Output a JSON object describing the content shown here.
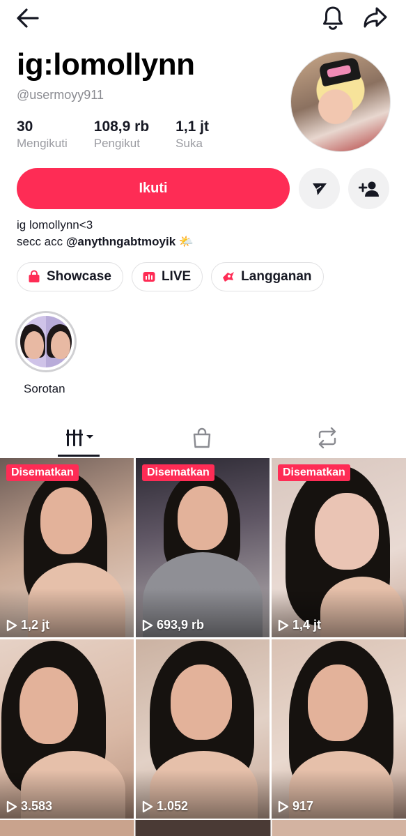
{
  "profile": {
    "display_name": "ig:lomollynn",
    "handle": "@usermoyy911",
    "stats": [
      {
        "value": "30",
        "label": "Mengikuti"
      },
      {
        "value": "108,9 rb",
        "label": "Pengikut"
      },
      {
        "value": "1,1 jt",
        "label": "Suka"
      }
    ],
    "follow_label": "Ikuti",
    "bio_line1": "ig lomollynn<3",
    "bio_line2_prefix": "secc acc ",
    "bio_line2_mention": "@anythngabtmoyik",
    "bio_line2_emoji": "🌤️"
  },
  "icons": {
    "back": "arrow-left-icon",
    "bell": "bell-icon",
    "share": "share-icon",
    "message": "send-icon",
    "add_friend": "add-user-icon",
    "showcase": "shopping-bag-icon",
    "live": "live-icon",
    "subscription": "subscription-icon",
    "videos_tab": "grid-icon",
    "shop_tab": "bag-icon",
    "repost_tab": "repost-icon",
    "play": "play-icon"
  },
  "chips": [
    {
      "label": "Showcase"
    },
    {
      "label": "LIVE"
    },
    {
      "label": "Langganan"
    }
  ],
  "highlights": [
    {
      "label": "Sorotan"
    }
  ],
  "videos": [
    {
      "pinned_label": "Disematkan",
      "views": "1,2 jt"
    },
    {
      "pinned_label": "Disematkan",
      "views": "693,9 rb"
    },
    {
      "pinned_label": "Disematkan",
      "views": "1,4 jt"
    },
    {
      "pinned_label": "",
      "views": "3.583"
    },
    {
      "pinned_label": "",
      "views": "1.052"
    },
    {
      "pinned_label": "",
      "views": "917"
    }
  ],
  "colors": {
    "accent": "#fe2c55",
    "text": "#161823",
    "muted": "#8a8b91"
  }
}
